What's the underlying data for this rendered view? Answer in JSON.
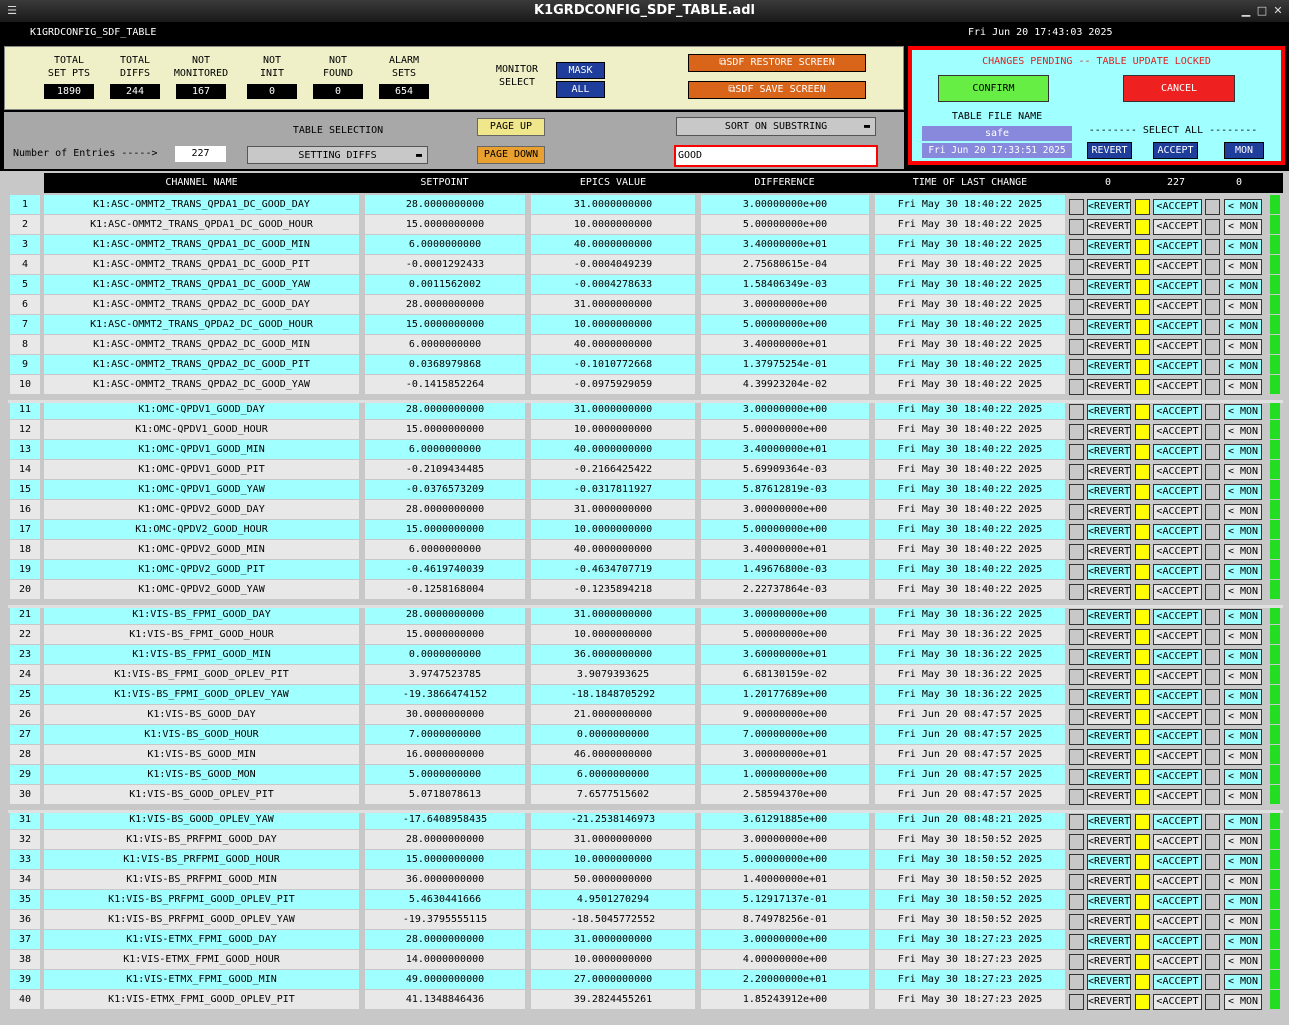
{
  "window": {
    "title": "K1GRDCONFIG_SDF_TABLE.adl",
    "min": "▁",
    "max": "□",
    "close": "✕",
    "menu": "☰"
  },
  "header": {
    "name": "K1GRDCONFIG_SDF_TABLE",
    "datetime": "Fri Jun 20 17:43:03 2025"
  },
  "stats": [
    {
      "label1": "TOTAL",
      "label2": "SET PTS",
      "value": "1890"
    },
    {
      "label1": "TOTAL",
      "label2": "DIFFS",
      "value": "244"
    },
    {
      "label1": "NOT",
      "label2": "MONITORED",
      "value": "167"
    },
    {
      "label1": "NOT",
      "label2": "INIT",
      "value": "0"
    },
    {
      "label1": "NOT",
      "label2": "FOUND",
      "value": "0"
    },
    {
      "label1": "ALARM",
      "label2": "SETS",
      "value": "654"
    }
  ],
  "monitor": {
    "label1": "MONITOR",
    "label2": "SELECT",
    "mask": "MASK",
    "all": "ALL"
  },
  "sdf": {
    "restore": "SDF RESTORE SCREEN",
    "save": "SDF SAVE SCREEN"
  },
  "pending": {
    "title": "CHANGES PENDING -- TABLE UPDATE LOCKED",
    "confirm": "CONFIRM",
    "cancel": "CANCEL",
    "file_label": "TABLE FILE NAME",
    "file_name": "safe",
    "file_time": "Fri Jun 20 17:33:51 2025",
    "select_all": "-------- SELECT ALL --------",
    "revert": "REVERT",
    "accept": "ACCEPT",
    "mon": "MON"
  },
  "table_sel": {
    "entries_label": "Number of Entries ----->",
    "entries": "227",
    "selection_label": "TABLE SELECTION",
    "selection": "SETTING DIFFS",
    "page_up": "PAGE UP",
    "page_down": "PAGE DOWN",
    "sort": "SORT ON SUBSTRING",
    "substring": "GOOD"
  },
  "columns": {
    "channel": "CHANNEL NAME",
    "setpoint": "SETPOINT",
    "epics": "EPICS VALUE",
    "diff": "DIFFERENCE",
    "time": "TIME OF LAST CHANGE",
    "c0": "0",
    "c227": "227",
    "c0b": "0"
  },
  "row_buttons": {
    "revert": "<REVERT",
    "accept": "<ACCEPT",
    "mon": "< MON"
  },
  "rows": [
    [
      "1",
      "K1:ASC-OMMT2_TRANS_QPDA1_DC_GOOD_DAY",
      "28.0000000000",
      "31.0000000000",
      "3.00000000e+00",
      "Fri May 30 18:40:22 2025"
    ],
    [
      "2",
      "K1:ASC-OMMT2_TRANS_QPDA1_DC_GOOD_HOUR",
      "15.0000000000",
      "10.0000000000",
      "5.00000000e+00",
      "Fri May 30 18:40:22 2025"
    ],
    [
      "3",
      "K1:ASC-OMMT2_TRANS_QPDA1_DC_GOOD_MIN",
      "6.0000000000",
      "40.0000000000",
      "3.40000000e+01",
      "Fri May 30 18:40:22 2025"
    ],
    [
      "4",
      "K1:ASC-OMMT2_TRANS_QPDA1_DC_GOOD_PIT",
      "-0.0001292433",
      "-0.0004049239",
      "2.75680615e-04",
      "Fri May 30 18:40:22 2025"
    ],
    [
      "5",
      "K1:ASC-OMMT2_TRANS_QPDA1_DC_GOOD_YAW",
      "0.0011562002",
      "-0.0004278633",
      "1.58406349e-03",
      "Fri May 30 18:40:22 2025"
    ],
    [
      "6",
      "K1:ASC-OMMT2_TRANS_QPDA2_DC_GOOD_DAY",
      "28.0000000000",
      "31.0000000000",
      "3.00000000e+00",
      "Fri May 30 18:40:22 2025"
    ],
    [
      "7",
      "K1:ASC-OMMT2_TRANS_QPDA2_DC_GOOD_HOUR",
      "15.0000000000",
      "10.0000000000",
      "5.00000000e+00",
      "Fri May 30 18:40:22 2025"
    ],
    [
      "8",
      "K1:ASC-OMMT2_TRANS_QPDA2_DC_GOOD_MIN",
      "6.0000000000",
      "40.0000000000",
      "3.40000000e+01",
      "Fri May 30 18:40:22 2025"
    ],
    [
      "9",
      "K1:ASC-OMMT2_TRANS_QPDA2_DC_GOOD_PIT",
      "0.0368979868",
      "-0.1010772668",
      "1.37975254e-01",
      "Fri May 30 18:40:22 2025"
    ],
    [
      "10",
      "K1:ASC-OMMT2_TRANS_QPDA2_DC_GOOD_YAW",
      "-0.1415852264",
      "-0.0975929059",
      "4.39923204e-02",
      "Fri May 30 18:40:22 2025"
    ],
    [
      "11",
      "K1:OMC-QPDV1_GOOD_DAY",
      "28.0000000000",
      "31.0000000000",
      "3.00000000e+00",
      "Fri May 30 18:40:22 2025"
    ],
    [
      "12",
      "K1:OMC-QPDV1_GOOD_HOUR",
      "15.0000000000",
      "10.0000000000",
      "5.00000000e+00",
      "Fri May 30 18:40:22 2025"
    ],
    [
      "13",
      "K1:OMC-QPDV1_GOOD_MIN",
      "6.0000000000",
      "40.0000000000",
      "3.40000000e+01",
      "Fri May 30 18:40:22 2025"
    ],
    [
      "14",
      "K1:OMC-QPDV1_GOOD_PIT",
      "-0.2109434485",
      "-0.2166425422",
      "5.69909364e-03",
      "Fri May 30 18:40:22 2025"
    ],
    [
      "15",
      "K1:OMC-QPDV1_GOOD_YAW",
      "-0.0376573209",
      "-0.0317811927",
      "5.87612819e-03",
      "Fri May 30 18:40:22 2025"
    ],
    [
      "16",
      "K1:OMC-QPDV2_GOOD_DAY",
      "28.0000000000",
      "31.0000000000",
      "3.00000000e+00",
      "Fri May 30 18:40:22 2025"
    ],
    [
      "17",
      "K1:OMC-QPDV2_GOOD_HOUR",
      "15.0000000000",
      "10.0000000000",
      "5.00000000e+00",
      "Fri May 30 18:40:22 2025"
    ],
    [
      "18",
      "K1:OMC-QPDV2_GOOD_MIN",
      "6.0000000000",
      "40.0000000000",
      "3.40000000e+01",
      "Fri May 30 18:40:22 2025"
    ],
    [
      "19",
      "K1:OMC-QPDV2_GOOD_PIT",
      "-0.4619740039",
      "-0.4634707719",
      "1.49676800e-03",
      "Fri May 30 18:40:22 2025"
    ],
    [
      "20",
      "K1:OMC-QPDV2_GOOD_YAW",
      "-0.1258168004",
      "-0.1235894218",
      "2.22737864e-03",
      "Fri May 30 18:40:22 2025"
    ],
    [
      "21",
      "K1:VIS-BS_FPMI_GOOD_DAY",
      "28.0000000000",
      "31.0000000000",
      "3.00000000e+00",
      "Fri May 30 18:36:22 2025"
    ],
    [
      "22",
      "K1:VIS-BS_FPMI_GOOD_HOUR",
      "15.0000000000",
      "10.0000000000",
      "5.00000000e+00",
      "Fri May 30 18:36:22 2025"
    ],
    [
      "23",
      "K1:VIS-BS_FPMI_GOOD_MIN",
      "0.0000000000",
      "36.0000000000",
      "3.60000000e+01",
      "Fri May 30 18:36:22 2025"
    ],
    [
      "24",
      "K1:VIS-BS_FPMI_GOOD_OPLEV_PIT",
      "3.9747523785",
      "3.9079393625",
      "6.68130159e-02",
      "Fri May 30 18:36:22 2025"
    ],
    [
      "25",
      "K1:VIS-BS_FPMI_GOOD_OPLEV_YAW",
      "-19.3866474152",
      "-18.1848705292",
      "1.20177689e+00",
      "Fri May 30 18:36:22 2025"
    ],
    [
      "26",
      "K1:VIS-BS_GOOD_DAY",
      "30.0000000000",
      "21.0000000000",
      "9.00000000e+00",
      "Fri Jun 20 08:47:57 2025"
    ],
    [
      "27",
      "K1:VIS-BS_GOOD_HOUR",
      "7.0000000000",
      "0.0000000000",
      "7.00000000e+00",
      "Fri Jun 20 08:47:57 2025"
    ],
    [
      "28",
      "K1:VIS-BS_GOOD_MIN",
      "16.0000000000",
      "46.0000000000",
      "3.00000000e+01",
      "Fri Jun 20 08:47:57 2025"
    ],
    [
      "29",
      "K1:VIS-BS_GOOD_MON",
      "5.0000000000",
      "6.0000000000",
      "1.00000000e+00",
      "Fri Jun 20 08:47:57 2025"
    ],
    [
      "30",
      "K1:VIS-BS_GOOD_OPLEV_PIT",
      "5.0718078613",
      "7.6577515602",
      "2.58594370e+00",
      "Fri Jun 20 08:47:57 2025"
    ],
    [
      "31",
      "K1:VIS-BS_GOOD_OPLEV_YAW",
      "-17.6408958435",
      "-21.2538146973",
      "3.61291885e+00",
      "Fri Jun 20 08:48:21 2025"
    ],
    [
      "32",
      "K1:VIS-BS_PRFPMI_GOOD_DAY",
      "28.0000000000",
      "31.0000000000",
      "3.00000000e+00",
      "Fri May 30 18:50:52 2025"
    ],
    [
      "33",
      "K1:VIS-BS_PRFPMI_GOOD_HOUR",
      "15.0000000000",
      "10.0000000000",
      "5.00000000e+00",
      "Fri May 30 18:50:52 2025"
    ],
    [
      "34",
      "K1:VIS-BS_PRFPMI_GOOD_MIN",
      "36.0000000000",
      "50.0000000000",
      "1.40000000e+01",
      "Fri May 30 18:50:52 2025"
    ],
    [
      "35",
      "K1:VIS-BS_PRFPMI_GOOD_OPLEV_PIT",
      "5.4630441666",
      "4.9501270294",
      "5.12917137e-01",
      "Fri May 30 18:50:52 2025"
    ],
    [
      "36",
      "K1:VIS-BS_PRFPMI_GOOD_OPLEV_YAW",
      "-19.3795555115",
      "-18.5045772552",
      "8.74978256e-01",
      "Fri May 30 18:50:52 2025"
    ],
    [
      "37",
      "K1:VIS-ETMX_FPMI_GOOD_DAY",
      "28.0000000000",
      "31.0000000000",
      "3.00000000e+00",
      "Fri May 30 18:27:23 2025"
    ],
    [
      "38",
      "K1:VIS-ETMX_FPMI_GOOD_HOUR",
      "14.0000000000",
      "10.0000000000",
      "4.00000000e+00",
      "Fri May 30 18:27:23 2025"
    ],
    [
      "39",
      "K1:VIS-ETMX_FPMI_GOOD_MIN",
      "49.0000000000",
      "27.0000000000",
      "2.20000000e+01",
      "Fri May 30 18:27:23 2025"
    ],
    [
      "40",
      "K1:VIS-ETMX_FPMI_GOOD_OPLEV_PIT",
      "41.1348846436",
      "39.2824455261",
      "1.85243912e+00",
      "Fri May 30 18:27:23 2025"
    ]
  ],
  "colors": {
    "cyan": "#a0ffff",
    "light": "#e8e8e8",
    "yellow": "#ffff00",
    "green": "#22dd22",
    "blue": "#1f3e9c",
    "orange": "#d9651b",
    "red": "#ff0000"
  }
}
